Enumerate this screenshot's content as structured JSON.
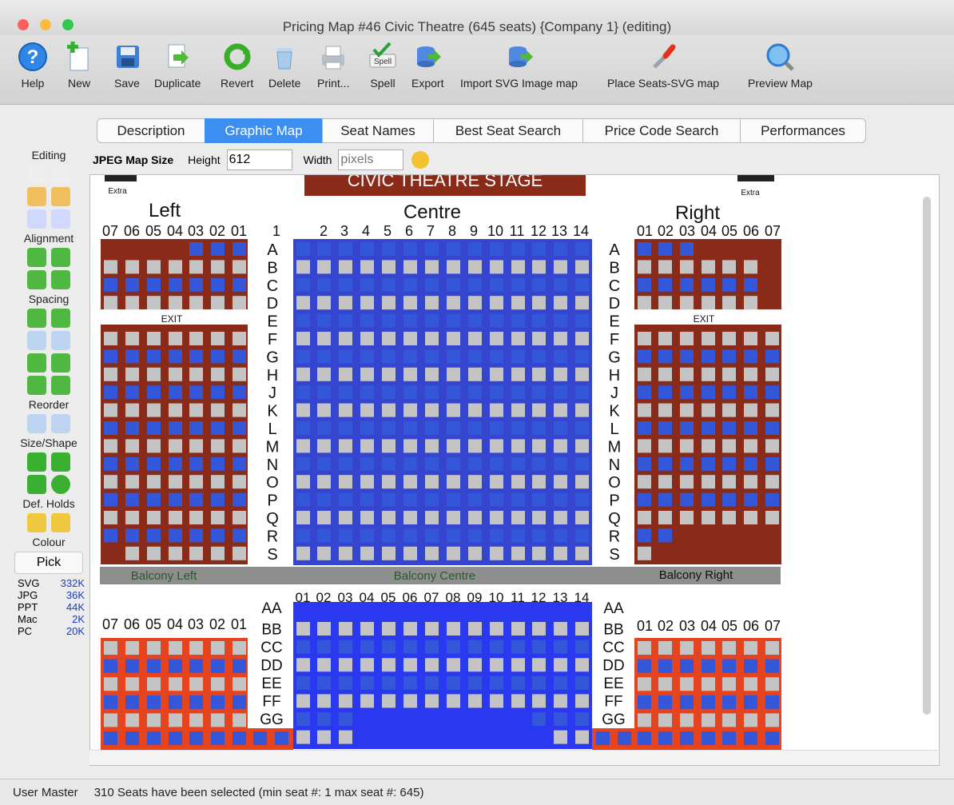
{
  "window": {
    "title": "Pricing Map #46 Civic Theatre (645 seats) {Company 1} (editing)"
  },
  "toolbar": [
    {
      "label": "Help",
      "icon": "help-icon"
    },
    {
      "label": "New",
      "icon": "new-document-icon"
    },
    {
      "label": "Save",
      "icon": "save-disk-icon"
    },
    {
      "label": "Duplicate",
      "icon": "duplicate-icon"
    },
    {
      "label": "Revert",
      "icon": "revert-icon"
    },
    {
      "label": "Delete",
      "icon": "trash-icon"
    },
    {
      "label": "Print...",
      "icon": "printer-icon"
    },
    {
      "label": "Spell",
      "icon": "spell-check-icon",
      "icon_text": "Spell"
    },
    {
      "label": "Export",
      "icon": "export-icon"
    },
    {
      "label": "Import SVG Image map",
      "icon": "import-database-icon"
    },
    {
      "label": "Place Seats-SVG map",
      "icon": "wrench-icon"
    },
    {
      "label": "Preview Map",
      "icon": "magnifier-globe-icon"
    }
  ],
  "tabs": [
    {
      "label": "Description",
      "active": false
    },
    {
      "label": "Graphic Map",
      "active": true
    },
    {
      "label": "Seat Names",
      "active": false
    },
    {
      "label": "Best Seat Search",
      "active": false
    },
    {
      "label": "Price Code Search",
      "active": false
    },
    {
      "label": "Performances",
      "active": false
    }
  ],
  "sidebar": {
    "editing": "Editing",
    "alignment": "Alignment",
    "spacing": "Spacing",
    "reorder": "Reorder",
    "size_shape": "Size/Shape",
    "def_holds": "Def. Holds",
    "colour": "Colour",
    "pick": "Pick",
    "sizes": [
      {
        "label": "SVG",
        "value": "332K"
      },
      {
        "label": "JPG",
        "value": "36K"
      },
      {
        "label": "PPT",
        "value": "44K"
      },
      {
        "label": "Mac",
        "value": "2K"
      },
      {
        "label": "PC",
        "value": "20K"
      }
    ]
  },
  "map_size": {
    "label": "JPEG Map Size",
    "height_label": "Height",
    "height_value": "612",
    "width_label": "Width",
    "width_placeholder": "pixels"
  },
  "seat_map": {
    "stage_text": "CIVIC THEATRE STAGE",
    "extra_label": "Extra",
    "exit_label": "EXIT",
    "sections": {
      "left": "Left",
      "centre": "Centre",
      "right": "Right"
    },
    "balcony_bar": {
      "left": "Balcony Left",
      "centre": "Balcony Centre",
      "right": "Balcony Right"
    },
    "left_seats": [
      "07",
      "06",
      "05",
      "04",
      "03",
      "02",
      "01"
    ],
    "right_seats": [
      "01",
      "02",
      "03",
      "04",
      "05",
      "06",
      "07"
    ],
    "centre_seats": [
      "1",
      "2",
      "3",
      "4",
      "5",
      "6",
      "7",
      "8",
      "9",
      "10",
      "11",
      "12",
      "13",
      "14"
    ],
    "rows": [
      "A",
      "B",
      "C",
      "D",
      "E",
      "F",
      "G",
      "H",
      "J",
      "K",
      "L",
      "M",
      "N",
      "O",
      "P",
      "Q",
      "R",
      "S"
    ],
    "balcony_seats": [
      "01",
      "02",
      "03",
      "04",
      "05",
      "06",
      "07",
      "08",
      "09",
      "10",
      "11",
      "12",
      "13",
      "14"
    ],
    "balcony_rows": [
      "AA",
      "BB",
      "CC",
      "DD",
      "EE",
      "FF",
      "GG"
    ],
    "colors": {
      "selected": "#3456d8",
      "unselected": "#c4c4c4",
      "left_right_bg": "#8a2a18",
      "centre_bg": "#3545d0",
      "balcony_side_bg": "#e5441e",
      "balcony_centre_bg": "#2a38f0",
      "balcony_bar": "#8e8e8e"
    }
  },
  "status": {
    "user": "User Master",
    "message": "310 Seats have been selected (min seat #: 1 max seat #: 645)"
  }
}
